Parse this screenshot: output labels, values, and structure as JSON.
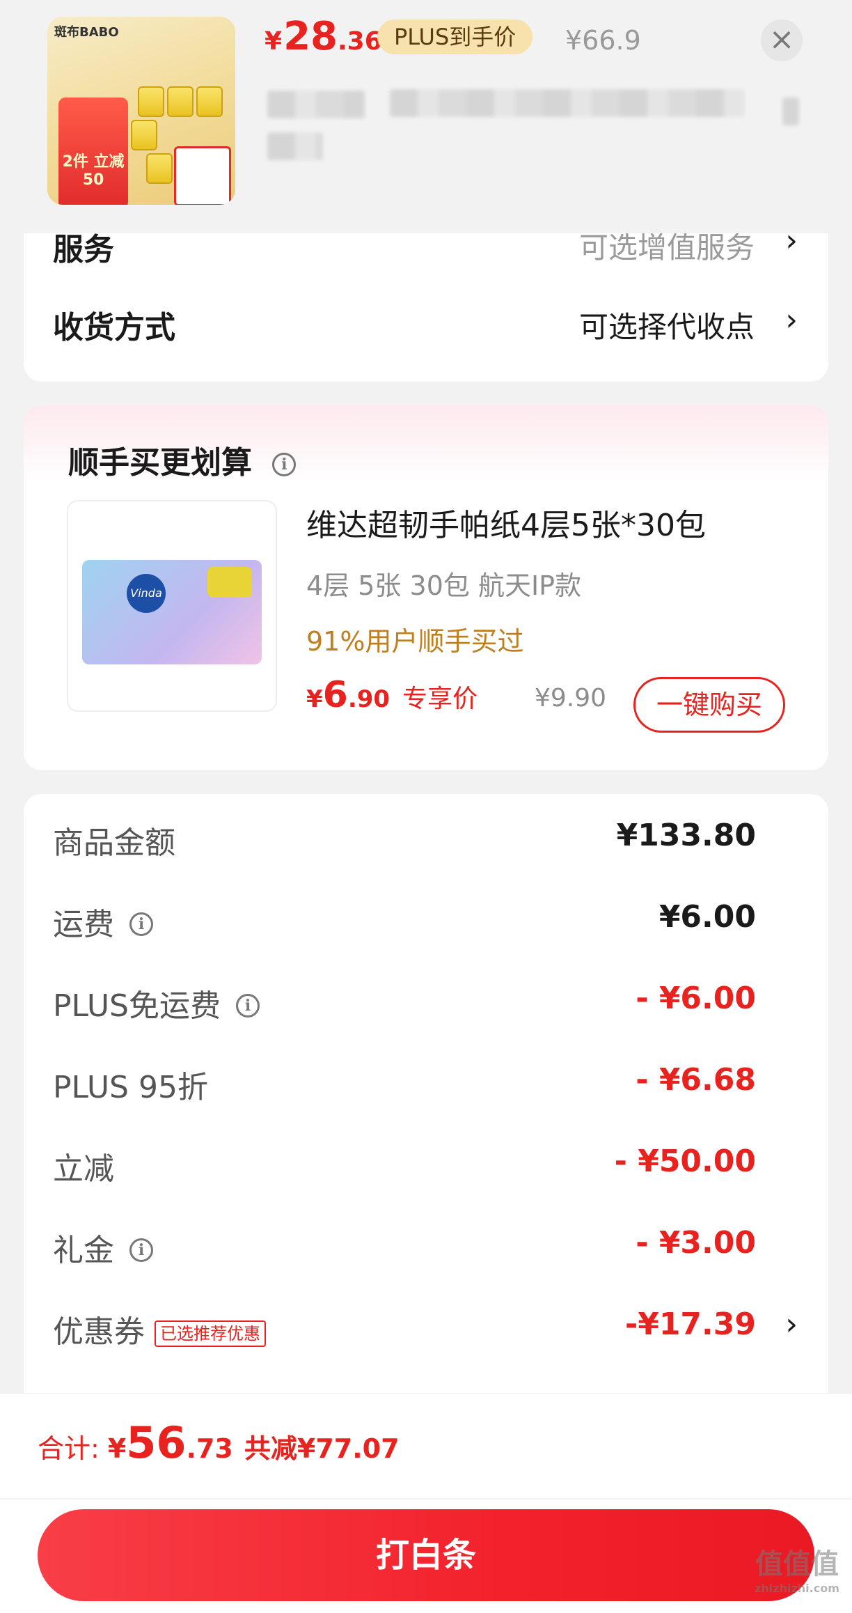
{
  "header": {
    "product_image_brand": "斑布BABO",
    "product_image_promo": "2件 立减50",
    "price_symbol": "¥",
    "price_int": "28",
    "price_dec": ".36",
    "plus_pill": "PLUS到手价",
    "original_price": "¥66.9",
    "close_icon": "close-icon"
  },
  "service_card": {
    "service_label": "服务",
    "service_value": "可选增值服务",
    "delivery_label": "收货方式",
    "delivery_value": "可选择代收点",
    "chevron": "›"
  },
  "addon": {
    "title": "顺手买更划算",
    "name": "维达超韧手帕纸4层5张*30包",
    "spec": "4层 5张 30包 航天IP款",
    "social": "91%用户顺手买过",
    "price_symbol": "¥",
    "price_int": "6",
    "price_dec": ".90",
    "price_tag": "专享价",
    "original_price": "¥9.90",
    "buy_button": "一键购买",
    "image_logo": "Vinda"
  },
  "summary": {
    "rows": [
      {
        "label": "商品金额",
        "value": "¥133.80",
        "info": false,
        "red": false
      },
      {
        "label": "运费",
        "value": "¥6.00",
        "info": true,
        "red": false
      },
      {
        "label": "PLUS免运费",
        "value": "- ¥6.00",
        "info": true,
        "red": true
      },
      {
        "label": "PLUS 95折",
        "value": "- ¥6.68",
        "info": false,
        "red": true
      },
      {
        "label": "立减",
        "value": "- ¥50.00",
        "info": false,
        "red": true
      },
      {
        "label": "礼金",
        "value": "- ¥3.00",
        "info": true,
        "red": true
      },
      {
        "label": "优惠券",
        "value": "-¥17.39",
        "info": false,
        "red": true
      }
    ],
    "coupon_tag": "已选推荐优惠",
    "chevron": "›"
  },
  "bottom": {
    "total_label": "合计:",
    "total_symbol": "¥",
    "total_int": "56",
    "total_dec": ".73",
    "total_saved": "共减¥77.07",
    "pay_button": "打白条"
  },
  "watermark": {
    "big": "值值值",
    "small": "zhizhizhi.com"
  },
  "colors": {
    "accent_red": "#e8231f",
    "plus_gold": "#f7e2ad",
    "social_gold": "#c07f1e"
  }
}
